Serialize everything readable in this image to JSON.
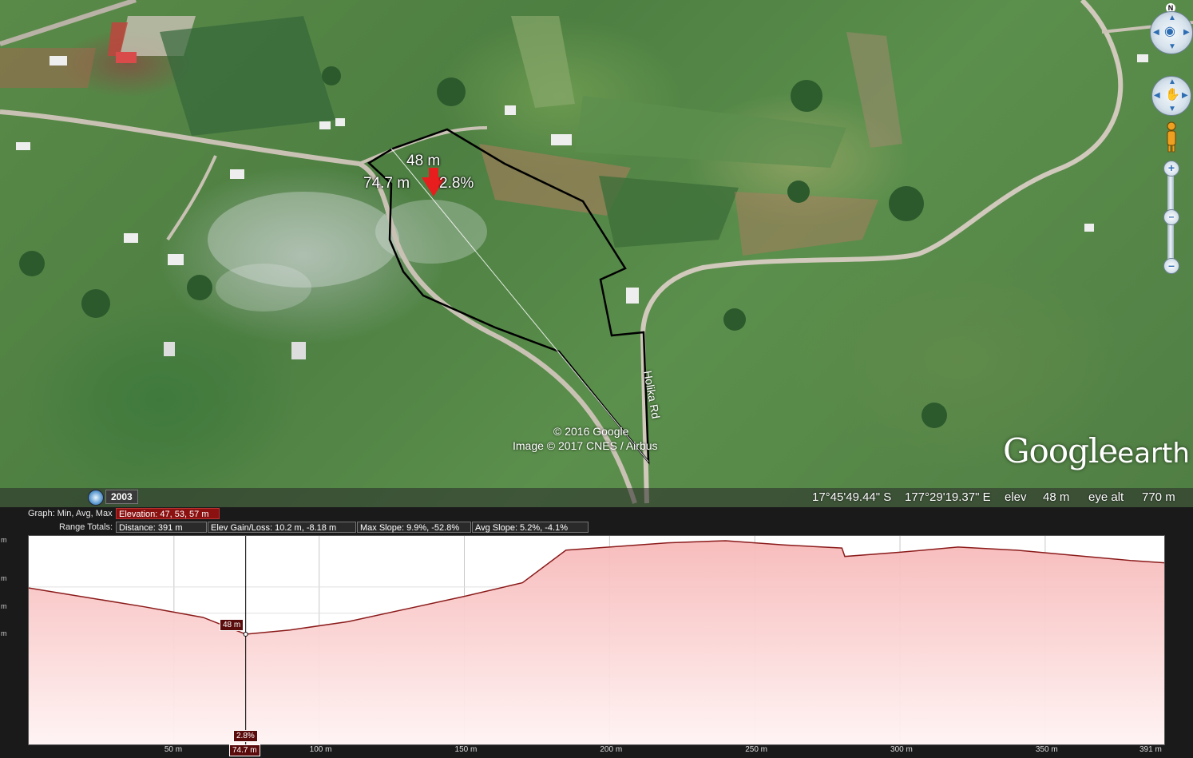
{
  "map": {
    "measure": {
      "elevation": "48 m",
      "distance": "74.7 m",
      "slope": "2.8%"
    },
    "road_label": "Holika Rd",
    "copyright_1": "© 2016 Google",
    "copyright_2": "Image © 2017 CNES / Airbus",
    "logo_main": "Google",
    "logo_sub": "earth",
    "historical_year": "2003",
    "compass_north": "N"
  },
  "status_bar": {
    "lat": "17°45'49.44\" S",
    "lon": "177°29'19.37\" E",
    "elev_label": "elev",
    "elev_value": "48 m",
    "eye_alt_label": "eye alt",
    "eye_alt_value": "770 m"
  },
  "profile": {
    "graph_label": "Graph: Min, Avg, Max",
    "elevation_stat": "Elevation: 47, 53, 57 m",
    "range_label": "Range Totals:",
    "distance_stat": "Distance: 391 m",
    "elev_gain_stat": "Elev Gain/Loss: 10.2 m, -8.18 m",
    "max_slope_stat": "Max Slope: 9.9%, -52.8%",
    "avg_slope_stat": "Avg Slope: 5.2%, -4.1%",
    "y_unit": "m",
    "cursor_elev_flag": "48 m",
    "cursor_slope_flag": "2.8%",
    "cursor_dist_flag": "74.7 m",
    "x_ticks": [
      "50 m",
      "100 m",
      "150 m",
      "200 m",
      "250 m",
      "300 m",
      "350 m",
      "391 m"
    ]
  },
  "chart_data": {
    "type": "area",
    "xlabel": "",
    "ylabel": "",
    "xlim": [
      0,
      391
    ],
    "x_ticks": [
      50,
      100,
      150,
      200,
      250,
      300,
      350,
      391
    ],
    "series": [
      {
        "x": [
          0,
          20,
          40,
          60,
          74.7,
          90,
          110,
          130,
          150,
          170,
          185,
          200,
          220,
          240,
          260,
          280,
          281,
          300,
          320,
          340,
          360,
          380,
          391
        ],
        "values": [
          52.4,
          51.5,
          50.6,
          49.6,
          48.0,
          48.4,
          49.2,
          50.4,
          51.6,
          52.9,
          56.0,
          56.3,
          56.7,
          56.9,
          56.5,
          56.2,
          55.4,
          55.8,
          56.3,
          56.0,
          55.5,
          55.0,
          54.8
        ],
        "color": "#8b1a1a"
      }
    ],
    "cursor": {
      "x": 74.7,
      "elevation": 48,
      "slope": 2.8
    }
  }
}
